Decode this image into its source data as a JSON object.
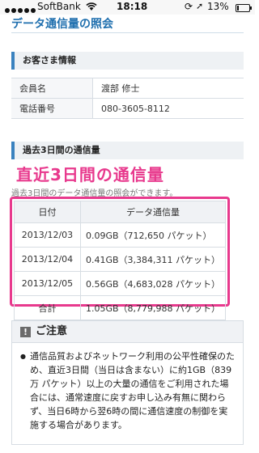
{
  "status_bar": {
    "carrier": "SoftBank",
    "time": "18:18",
    "battery_text": "13%",
    "battery_level_percent": 13,
    "signal_dots": 5
  },
  "page": {
    "title": "データ通信量の照会"
  },
  "customer_info": {
    "heading": "お客さま情報",
    "rows": [
      {
        "label": "会員名",
        "value": "渡部 修士"
      },
      {
        "label": "電話番号",
        "value": "080-3605-8112"
      }
    ]
  },
  "usage": {
    "heading": "過去3日間の通信量",
    "overlay_caption": "直近3日間の通信量",
    "behind_text": "過去3日間のデータ通信量の照会ができます。",
    "columns": [
      "日付",
      "データ通信量"
    ],
    "rows": [
      {
        "date": "2013/12/03",
        "amount": "0.09GB（712,650 パケット）"
      },
      {
        "date": "2013/12/04",
        "amount": "0.41GB（3,384,311 パケット）"
      },
      {
        "date": "2013/12/05",
        "amount": "0.56GB（4,683,028 パケット）"
      },
      {
        "date": "合計",
        "amount": "1.05GB（8,779,988 パケット）"
      }
    ],
    "highlight_color": "#e8398d"
  },
  "notice": {
    "heading": "ご注意",
    "icon": "exclamation-icon",
    "body": "通信品質およびネットワーク利用の公平性確保のため、直近3日間（当日は含まない）に約1GB（839万 パケット）以上の大量の通信をご利用された場合には、通常速度に戻すお申し込み有無に関わらず、当日6時から翌6時の間に通信速度の制御を実施する場合があります。"
  },
  "colors": {
    "accent_blue": "#1f6fae",
    "highlight_pink": "#e8398d"
  }
}
